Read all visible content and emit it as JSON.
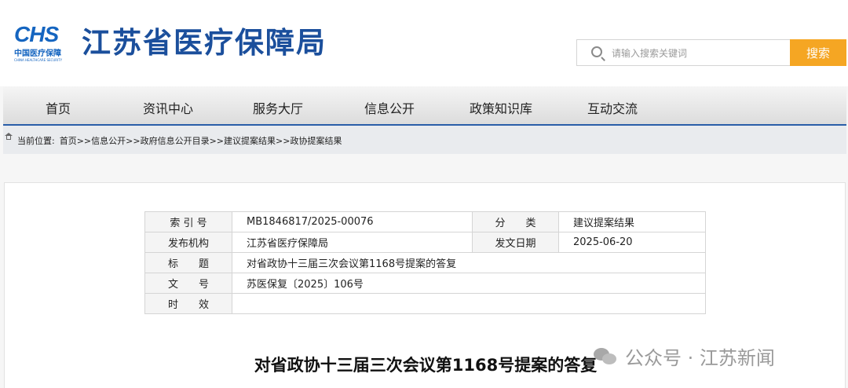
{
  "logo": {
    "mark": "CHS",
    "cn": "中国医疗保障",
    "en": "CHINA HEALTHCARE SECURITY"
  },
  "site_title": "江苏省医疗保障局",
  "search": {
    "placeholder": "请输入搜索关键词",
    "button": "搜索"
  },
  "nav": [
    "首页",
    "资讯中心",
    "服务大厅",
    "信息公开",
    "政策知识库",
    "互动交流"
  ],
  "breadcrumb": {
    "label": "当前位置:",
    "items": [
      "首页",
      "信息公开",
      "政府信息公开目录",
      "建议提案结果",
      "政协提案结果"
    ],
    "separator": ">>"
  },
  "meta": {
    "index_label": "索 引 号",
    "index_value": "MB1846817/2025-00076",
    "category_label": "分　　类",
    "category_value": "建议提案结果",
    "publisher_label": "发布机构",
    "publisher_value": "江苏省医疗保障局",
    "date_label": "发文日期",
    "date_value": "2025-06-20",
    "title_label": "标　　题",
    "title_value": "对省政协十三届三次会议第1168号提案的答复",
    "docno_label": "文　　号",
    "docno_value": "苏医保复〔2025〕106号",
    "validity_label": "时　　效",
    "validity_value": ""
  },
  "doc_title": "对省政协十三届三次会议第1168号提案的答复",
  "watermark": {
    "text": "公众号 · 江苏新闻",
    "icon": "wechat-icon"
  },
  "colors": {
    "brand_blue": "#1b4f9c",
    "search_orange": "#f5a623",
    "nav_border": "#2a5ea8"
  }
}
